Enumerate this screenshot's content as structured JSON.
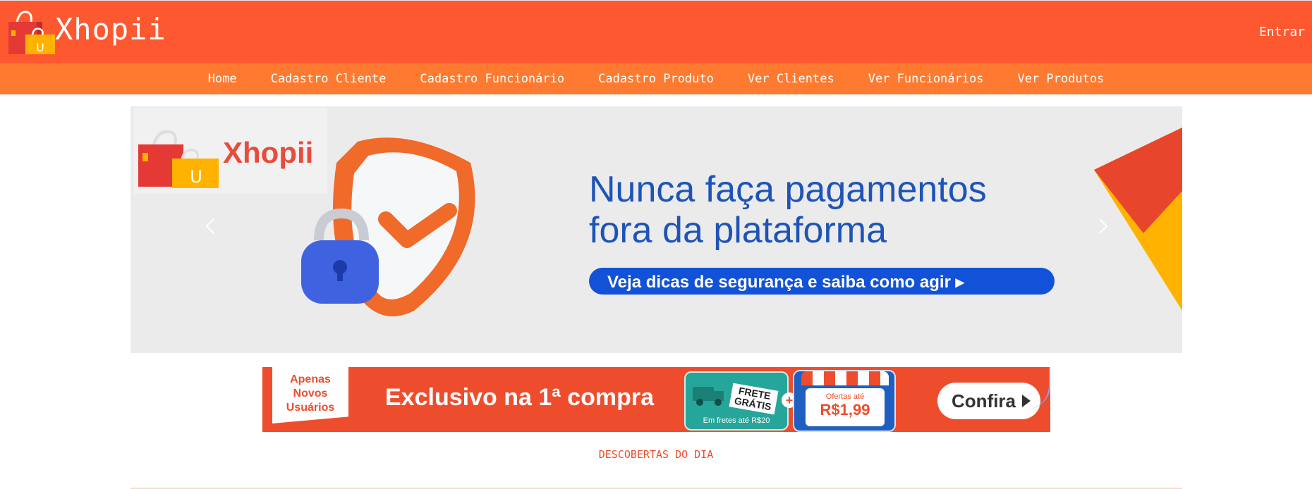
{
  "header": {
    "brand": "Xhopii",
    "login_label": "Entrar"
  },
  "nav": {
    "items": [
      {
        "label": "Home"
      },
      {
        "label": "Cadastro Cliente"
      },
      {
        "label": "Cadastro Funcionário"
      },
      {
        "label": "Cadastro Produto"
      },
      {
        "label": "Ver Clientes"
      },
      {
        "label": "Ver Funcionários"
      },
      {
        "label": "Ver Produtos"
      }
    ]
  },
  "carousel": {
    "brand": "Xhopii",
    "headline_line1": "Nunca faça pagamentos",
    "headline_line2": "fora da plataforma",
    "cta": "Veja dicas de segurança e saiba como agir ▸",
    "prev_icon": "chevron-left-icon",
    "next_icon": "chevron-right-icon"
  },
  "promo": {
    "tag": "Apenas Novos Usuários",
    "headline": "Exclusivo na 1ª compra",
    "frete_title": "FRETE\nGRÁTIS",
    "frete_sub": "Em fretes até R$20",
    "plus": "+",
    "ofertas_label": "Ofertas até",
    "ofertas_value": "R$1,99",
    "button_label": "Confira"
  },
  "section": {
    "title": "DESCOBERTAS DO DIA"
  },
  "colors": {
    "header_bg": "#fe5831",
    "nav_bg": "#fe7a30",
    "accent": "#ee4d2d",
    "banner_blue": "#1e54b7"
  }
}
